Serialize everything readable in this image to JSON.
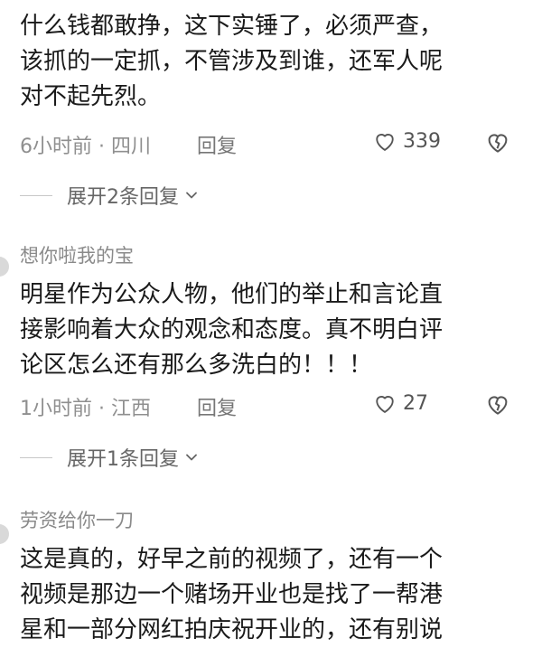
{
  "comments": [
    {
      "username": "",
      "lines": [
        "什么钱都敢挣，这下实锤了，必须严查，",
        "该抓的一定抓，不管涉及到谁，还军人呢",
        "对不起先烈。"
      ],
      "time_location": "6小时前 · 四川",
      "reply_label": "回复",
      "likes": "339",
      "expand_label": "展开2条回复"
    },
    {
      "username": "想你啦我的宝",
      "lines": [
        "明星作为公众人物，他们的举止和言论直",
        "接影响着大众的观念和态度。真不明白评",
        "论区怎么还有那么多洗白的！！！"
      ],
      "time_location": "1小时前 · 江西",
      "reply_label": "回复",
      "likes": "27",
      "expand_label": "展开1条回复"
    },
    {
      "username": "劳资给你一刀",
      "lines": [
        "这是真的，好早之前的视频了，还有一个",
        "视频是那边一个赌场开业也是找了一帮港",
        "星和一部分网红拍庆祝开业的，还有别说"
      ]
    }
  ],
  "icons": {
    "like": "heart-outline-icon",
    "dislike": "broken-heart-icon",
    "expand": "chevron-down-icon"
  }
}
